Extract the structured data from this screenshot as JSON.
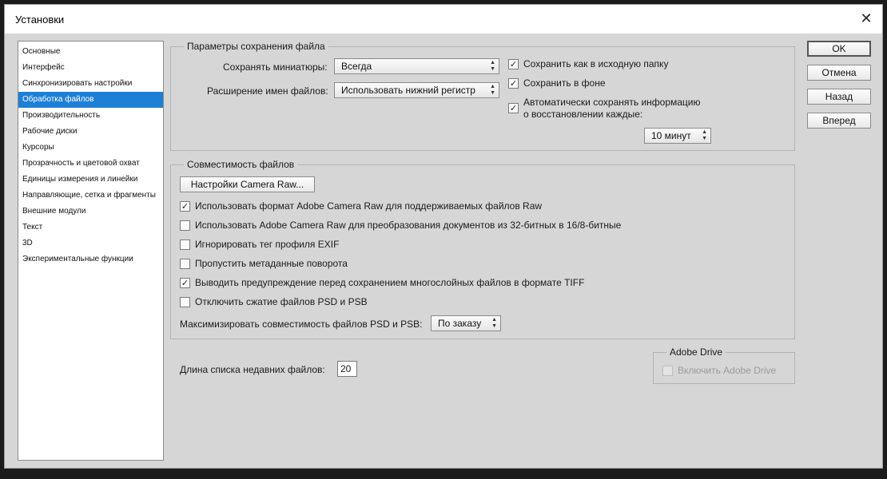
{
  "window": {
    "title": "Установки",
    "close_glyph": "✕"
  },
  "sidebar": {
    "items": [
      {
        "label": "Основные"
      },
      {
        "label": "Интерфейс"
      },
      {
        "label": "Синхронизировать настройки"
      },
      {
        "label": "Обработка файлов",
        "selected": true
      },
      {
        "label": "Производительность"
      },
      {
        "label": "Рабочие диски"
      },
      {
        "label": "Курсоры"
      },
      {
        "label": "Прозрачность и цветовой охват"
      },
      {
        "label": "Единицы измерения и линейки"
      },
      {
        "label": "Направляющие, сетка и фрагменты"
      },
      {
        "label": "Внешние модули"
      },
      {
        "label": "Текст"
      },
      {
        "label": "3D"
      },
      {
        "label": "Экспериментальные функции"
      }
    ]
  },
  "save_options": {
    "legend": "Параметры сохранения файла",
    "thumbnails_label": "Сохранять миниатюры:",
    "thumbnails_value": "Всегда",
    "extension_label": "Расширение имен файлов:",
    "extension_value": "Использовать нижний регистр",
    "save_original_folder": {
      "label": "Сохранить как в исходную папку",
      "checked": true
    },
    "save_background": {
      "label": "Сохранить в фоне",
      "checked": true
    },
    "autosave": {
      "label_line1": "Автоматически сохранять информацию",
      "label_line2": "о восстановлении каждые:",
      "checked": true
    },
    "autosave_interval": "10 минут"
  },
  "compatibility": {
    "legend": "Совместимость файлов",
    "camera_raw_button": "Настройки Camera Raw...",
    "options": [
      {
        "label": "Использовать формат Adobe Camera Raw для поддерживаемых файлов Raw",
        "checked": true
      },
      {
        "label": "Использовать Adobe Camera Raw для преобразования документов из 32-битных в 16/8-битные",
        "checked": false
      },
      {
        "label": "Игнорировать тег профиля EXIF",
        "checked": false
      },
      {
        "label": "Пропустить метаданные поворота",
        "checked": false
      },
      {
        "label": "Выводить предупреждение перед сохранением многослойных файлов в формате TIFF",
        "checked": true
      },
      {
        "label": "Отключить сжатие файлов PSD и PSB",
        "checked": false
      }
    ],
    "maximize_label": "Максимизировать совместимость файлов PSD и PSB:",
    "maximize_value": "По заказу"
  },
  "recent_files": {
    "label": "Длина списка недавних файлов:",
    "value": "20"
  },
  "adobe_drive": {
    "legend": "Adobe Drive",
    "enable_label": "Включить Adobe Drive",
    "checked": false
  },
  "buttons": {
    "ok": "OK",
    "cancel": "Отмена",
    "back": "Назад",
    "forward": "Вперед"
  },
  "glyphs": {
    "check": "✓",
    "spinner_up": "▲",
    "spinner_down": "▼"
  }
}
